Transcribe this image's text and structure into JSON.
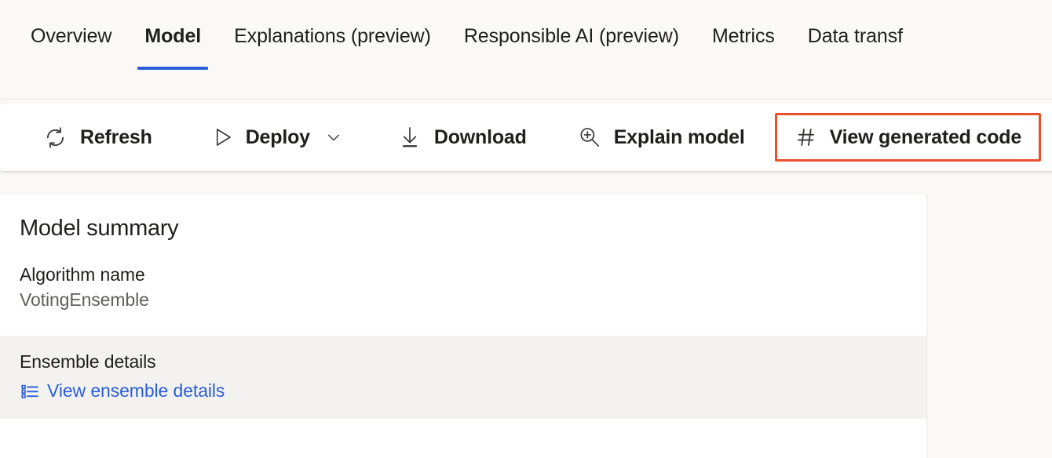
{
  "colors": {
    "accent": "#2b5fd9",
    "highlight": "#e8502a",
    "link": "#2b5fd9",
    "page_background": "#faf9f8",
    "card_background": "#ffffff",
    "band_background": "#f3f2f1",
    "text_primary": "#201f1e",
    "text_secondary": "#605e5c"
  },
  "tabs": [
    {
      "label": "Overview",
      "active": false,
      "icon": ""
    },
    {
      "label": "Model",
      "active": true,
      "icon": ""
    },
    {
      "label": "Explanations (preview)",
      "active": false,
      "icon": ""
    },
    {
      "label": "Responsible AI (preview)",
      "active": false,
      "icon": ""
    },
    {
      "label": "Metrics",
      "active": false,
      "icon": ""
    },
    {
      "label": "Data transf",
      "active": false,
      "icon": ""
    }
  ],
  "toolbar": {
    "refresh_label": "Refresh",
    "refresh_icon": "refresh-icon",
    "deploy_label": "Deploy",
    "deploy_icon": "play-triangle-icon",
    "deploy_chevron_icon": "chevron-down-icon",
    "download_label": "Download",
    "download_icon": "download-arrow-icon",
    "explain_label": "Explain model",
    "explain_icon": "zoom-in-magnifier-icon",
    "view_code_label": "View generated code",
    "view_code_icon": "hash-icon",
    "view_code_highlighted": true
  },
  "main": {
    "card_title": "Model summary",
    "algorithm": {
      "label": "Algorithm name",
      "value": "VotingEnsemble"
    },
    "ensemble": {
      "label": "Ensemble details",
      "link_text": "View ensemble details",
      "link_icon": "bulleted-list-icon"
    }
  }
}
